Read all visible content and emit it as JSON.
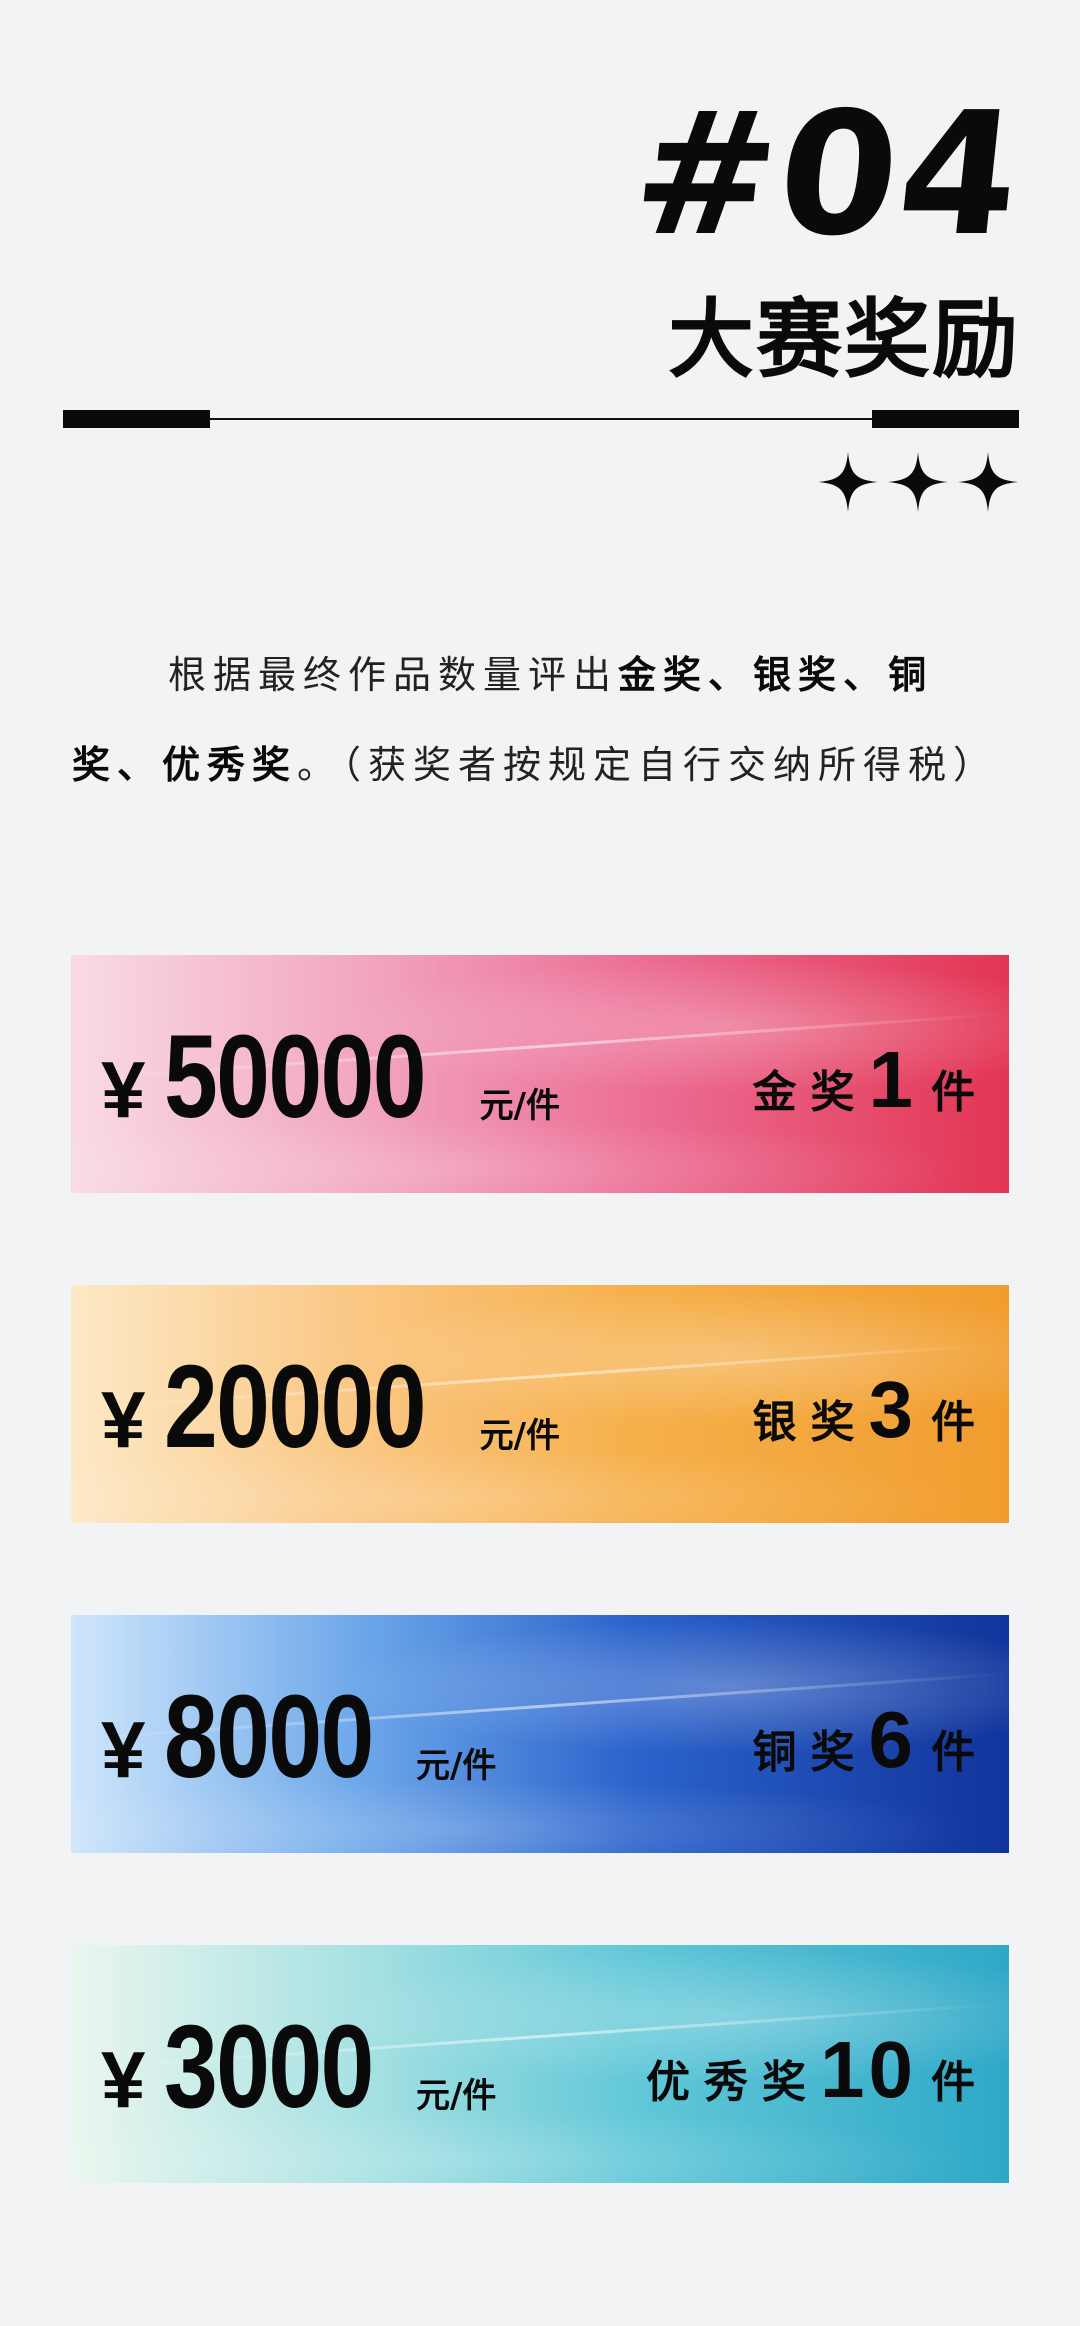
{
  "header": {
    "section_number": "#04",
    "section_title": "大赛奖励"
  },
  "intro": {
    "lead": "根据最终作品数量评出",
    "awards_inline": [
      "金奖",
      "、",
      "银奖",
      "、",
      "铜奖",
      "、",
      "优秀奖"
    ],
    "tail": "。（获奖者按规定自行交纳所得税）"
  },
  "prizes": [
    {
      "currency": "¥",
      "amount": "50000",
      "unit": "元/件",
      "award": "金奖",
      "count": "1",
      "measure": "件",
      "color": "#e33553"
    },
    {
      "currency": "¥",
      "amount": "20000",
      "unit": "元/件",
      "award": "银奖",
      "count": "3",
      "measure": "件",
      "color": "#f19d2e"
    },
    {
      "currency": "¥",
      "amount": "8000",
      "unit": "元/件",
      "award": "铜奖",
      "count": "6",
      "measure": "件",
      "color": "#11349c"
    },
    {
      "currency": "¥",
      "amount": "3000",
      "unit": "元/件",
      "award": "优秀奖",
      "count": "10",
      "measure": "件",
      "color": "#2ea8c7"
    }
  ]
}
